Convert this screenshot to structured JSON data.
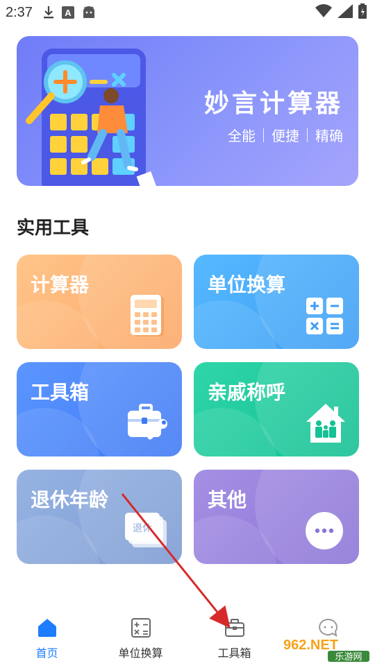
{
  "status_bar": {
    "time": "2:37",
    "icons": [
      "download-icon",
      "a-notification-icon",
      "android-icon",
      "wifi-icon",
      "signal-icon",
      "battery-icon"
    ]
  },
  "banner": {
    "title": "妙言计算器",
    "subtitle_parts": [
      "全能",
      "便捷",
      "精确"
    ]
  },
  "section": {
    "title": "实用工具"
  },
  "tools": [
    {
      "label": "计算器",
      "icon": "calculator-icon",
      "color": "#fcb371"
    },
    {
      "label": "单位换算",
      "icon": "math-operators-icon",
      "color": "#47abfa"
    },
    {
      "label": "工具箱",
      "icon": "toolbox-icon",
      "color": "#4b86f8"
    },
    {
      "label": "亲戚称呼",
      "icon": "family-house-icon",
      "color": "#1ccb9c"
    },
    {
      "label": "退休年龄",
      "icon": "retire-cards-icon",
      "color": "#89a7db"
    },
    {
      "label": "其他",
      "icon": "more-dots-icon",
      "color": "#9882dd"
    }
  ],
  "retire_card_text": "退休",
  "tab_bar": {
    "tabs": [
      {
        "label": "首页",
        "icon": "home-icon",
        "active": true
      },
      {
        "label": "单位换算",
        "icon": "calculator-grid-icon",
        "active": false
      },
      {
        "label": "工具箱",
        "icon": "toolbox-icon",
        "active": false
      },
      {
        "label": "",
        "icon": "chat-icon",
        "active": false
      }
    ]
  },
  "watermark": {
    "top": "962.NET",
    "bottom": "乐游网"
  }
}
